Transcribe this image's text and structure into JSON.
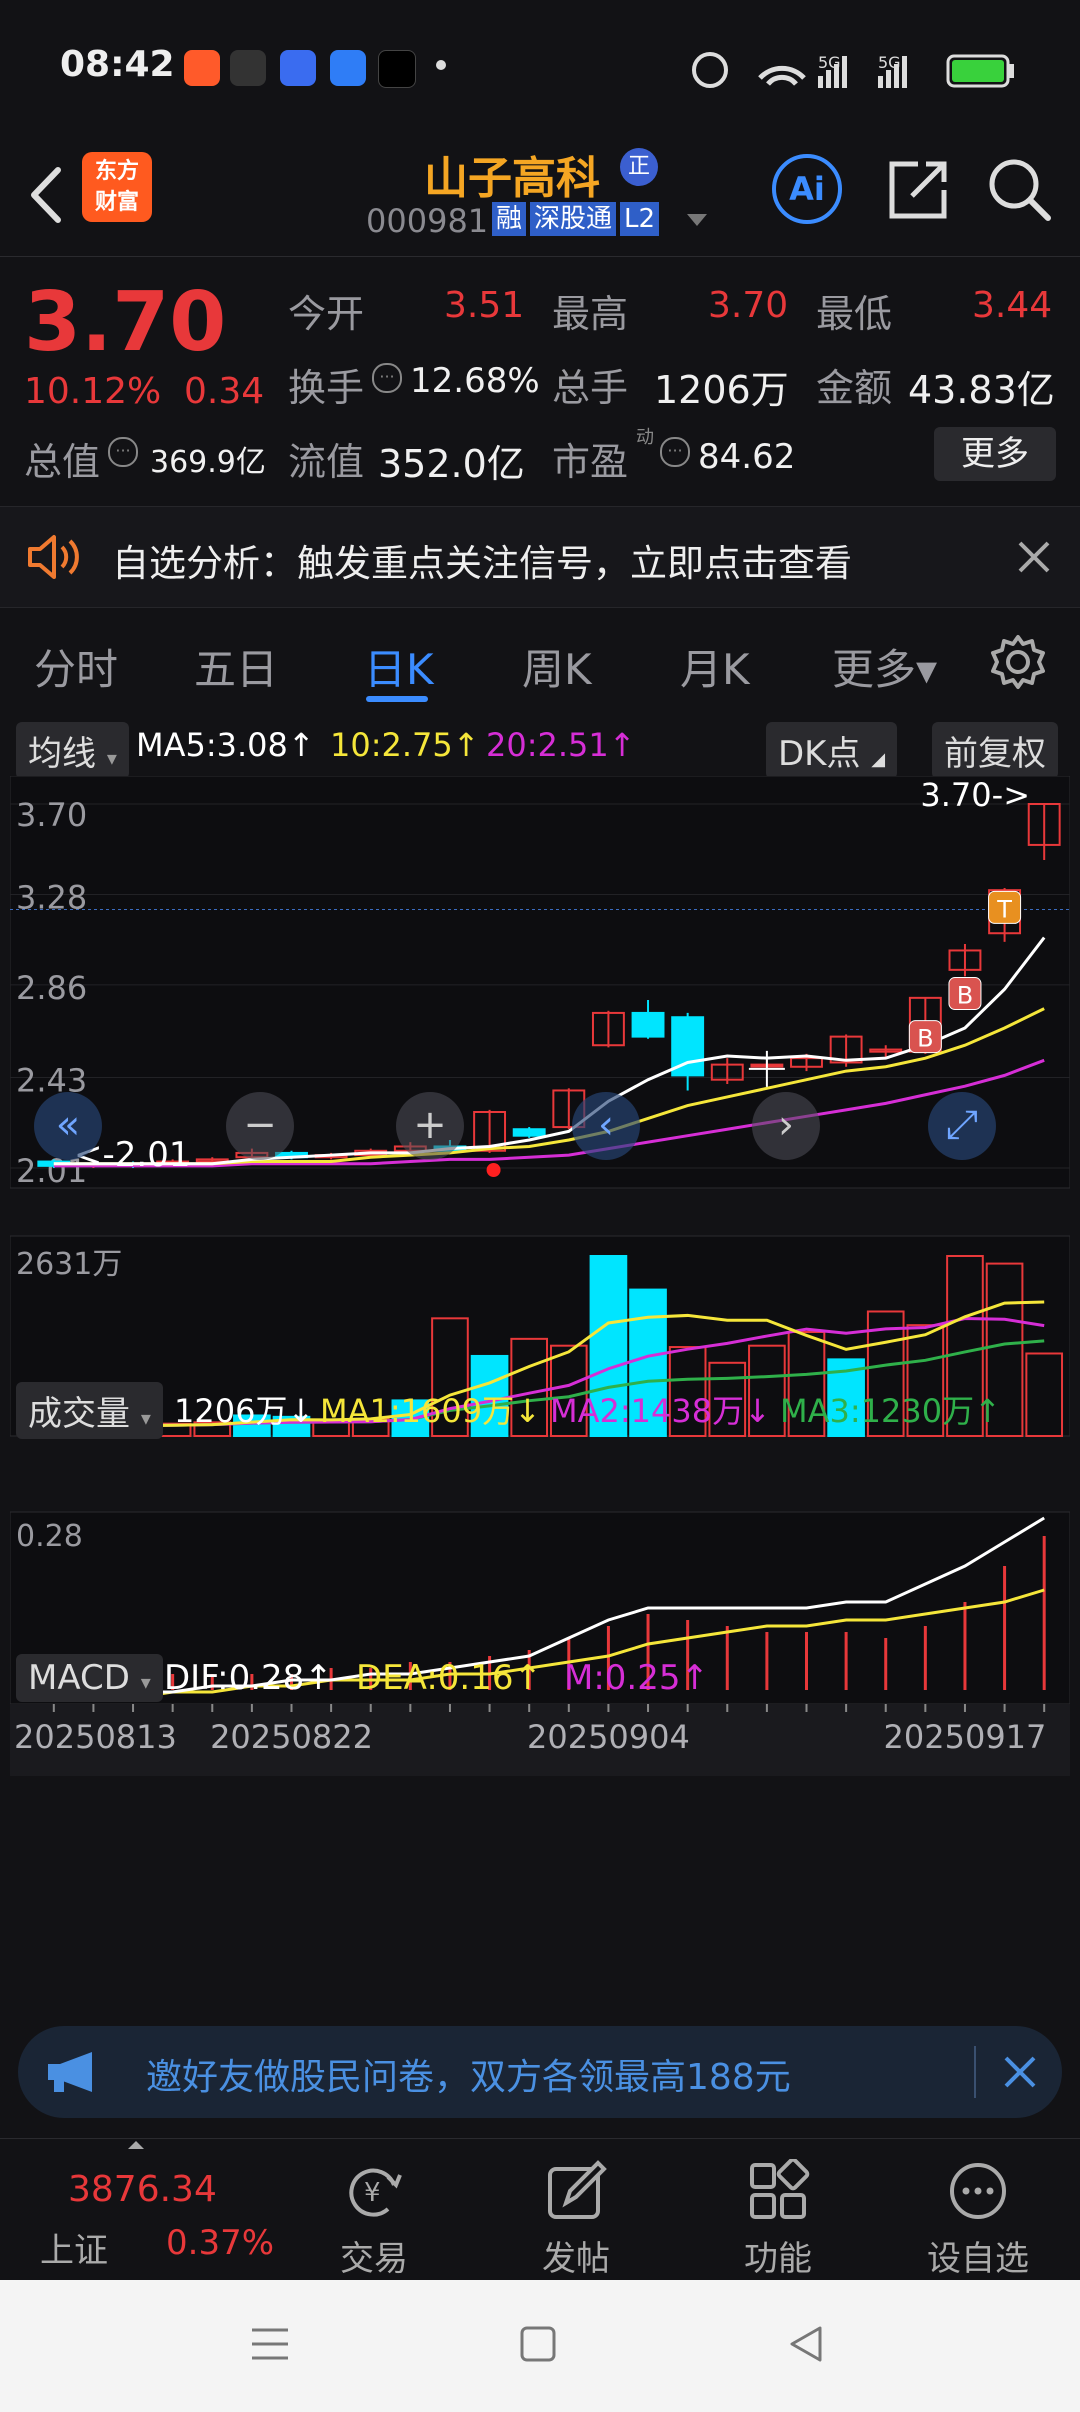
{
  "status": {
    "time": "08:42",
    "network": "5G",
    "network2": "5G"
  },
  "header": {
    "logo_line1": "东方",
    "logo_line2": "财富",
    "stock_name": "山子高科",
    "badge": "正",
    "code": "000981",
    "tags": [
      "融",
      "深股通",
      "L2"
    ],
    "ai_label": "Ai"
  },
  "quote": {
    "price": "3.70",
    "change_pct": "10.12%",
    "change": "0.34",
    "open_label": "今开",
    "open": "3.51",
    "high_label": "最高",
    "high": "3.70",
    "low_label": "最低",
    "low": "3.44",
    "turnover_label": "换手",
    "turnover": "12.68%",
    "volume_label": "总手",
    "volume": "1206万",
    "amount_label": "金额",
    "amount": "43.83亿",
    "mktcap_label": "总值",
    "mktcap": "369.9亿",
    "float_label": "流值",
    "float_cap": "352.0亿",
    "pe_label": "市盈",
    "pe_sup": "动",
    "pe": "84.62",
    "more": "更多"
  },
  "banner": {
    "text": "自选分析：触发重点关注信号，立即点击查看"
  },
  "tabs": [
    {
      "label": "分时"
    },
    {
      "label": "五日"
    },
    {
      "label": "日K"
    },
    {
      "label": "周K"
    },
    {
      "label": "月K"
    },
    {
      "label": "更多▾"
    }
  ],
  "kline": {
    "indicator": "均线",
    "ma5": "MA5:3.08↑",
    "ma10": "10:2.75↑",
    "ma20": "20:2.51↑",
    "dk": "DK点",
    "adjust": "前复权",
    "y_labels": [
      "3.70",
      "3.28",
      "2.86",
      "2.43",
      "2.01"
    ],
    "last_marker": "3.70->",
    "low_marker": "<-2.01",
    "marks": [
      "B",
      "B",
      "T"
    ]
  },
  "volume": {
    "selector": "成交量",
    "vol": "1206万↓",
    "ma1": "MA1:1609万↓",
    "ma2": "MA2:1438万↓",
    "ma3": "MA3:1230万↑",
    "max_label": "2631万"
  },
  "macd": {
    "selector": "MACD",
    "dif": "DIF:0.28↑",
    "dea": "DEA:0.16↑",
    "m": "M:0.25↑",
    "y_top": "0.28",
    "y_bottom": "-0.02",
    "dates": [
      "20250813",
      "20250822",
      "20250904",
      "20250917"
    ]
  },
  "invite": {
    "text": "邀好友做股民问卷，双方各领最高188元"
  },
  "bottomnav": {
    "index_value": "3876.34",
    "index_name": "上证",
    "index_change": "0.37%",
    "items": [
      {
        "label": "交易",
        "icon": "yuan-exchange-icon"
      },
      {
        "label": "发帖",
        "icon": "edit-post-icon"
      },
      {
        "label": "功能",
        "icon": "grid-icon"
      },
      {
        "label": "设自选",
        "icon": "more-dots-icon"
      }
    ]
  },
  "colors": {
    "up": "#e8383a",
    "down": "#00e5ff",
    "ma5": "#ffffff",
    "ma10": "#f5e63a",
    "ma20": "#d62ed6",
    "accent": "#3b8cff"
  },
  "chart_data": {
    "type": "candlestick",
    "candles": [
      {
        "o": 2.04,
        "c": 2.02,
        "h": 2.05,
        "l": 2.01
      },
      {
        "o": 2.02,
        "c": 2.03,
        "h": 2.04,
        "l": 2.01
      },
      {
        "o": 2.03,
        "c": 2.02,
        "h": 2.04,
        "l": 2.01
      },
      {
        "o": 2.02,
        "c": 2.04,
        "h": 2.05,
        "l": 2.02
      },
      {
        "o": 2.04,
        "c": 2.05,
        "h": 2.06,
        "l": 2.03
      },
      {
        "o": 2.06,
        "c": 2.08,
        "h": 2.1,
        "l": 2.05
      },
      {
        "o": 2.08,
        "c": 2.06,
        "h": 2.09,
        "l": 2.05
      },
      {
        "o": 2.06,
        "c": 2.07,
        "h": 2.08,
        "l": 2.05
      },
      {
        "o": 2.07,
        "c": 2.09,
        "h": 2.1,
        "l": 2.06
      },
      {
        "o": 2.09,
        "c": 2.11,
        "h": 2.13,
        "l": 2.08
      },
      {
        "o": 2.11,
        "c": 2.09,
        "h": 2.14,
        "l": 2.08
      },
      {
        "o": 2.09,
        "c": 2.27,
        "h": 2.28,
        "l": 2.08
      },
      {
        "o": 2.19,
        "c": 2.16,
        "h": 2.2,
        "l": 2.15
      },
      {
        "o": 2.2,
        "c": 2.37,
        "h": 2.38,
        "l": 2.19
      },
      {
        "o": 2.58,
        "c": 2.73,
        "h": 2.74,
        "l": 2.57
      },
      {
        "o": 2.73,
        "c": 2.62,
        "h": 2.79,
        "l": 2.61
      },
      {
        "o": 2.71,
        "c": 2.44,
        "h": 2.73,
        "l": 2.37
      },
      {
        "o": 2.42,
        "c": 2.49,
        "h": 2.52,
        "l": 2.4
      },
      {
        "o": 2.49,
        "c": 2.49,
        "h": 2.51,
        "l": 2.47
      },
      {
        "o": 2.48,
        "c": 2.52,
        "h": 2.54,
        "l": 2.46
      },
      {
        "o": 2.5,
        "c": 2.62,
        "h": 2.63,
        "l": 2.48
      },
      {
        "o": 2.55,
        "c": 2.56,
        "h": 2.58,
        "l": 2.52
      },
      {
        "o": 2.55,
        "c": 2.8,
        "h": 2.8,
        "l": 2.54
      },
      {
        "o": 2.93,
        "c": 3.02,
        "h": 3.05,
        "l": 2.9
      },
      {
        "o": 3.1,
        "c": 3.3,
        "h": 3.31,
        "l": 3.06
      },
      {
        "o": 3.51,
        "c": 3.7,
        "h": 3.7,
        "l": 3.44
      }
    ],
    "ma5": [
      2.03,
      2.03,
      2.03,
      2.03,
      2.03,
      2.05,
      2.06,
      2.07,
      2.08,
      2.08,
      2.1,
      2.11,
      2.14,
      2.18,
      2.32,
      2.42,
      2.5,
      2.53,
      2.52,
      2.53,
      2.51,
      2.52,
      2.58,
      2.66,
      2.84,
      3.08
    ],
    "ma10": [
      2.03,
      2.03,
      2.03,
      2.03,
      2.03,
      2.04,
      2.04,
      2.04,
      2.06,
      2.07,
      2.08,
      2.1,
      2.11,
      2.14,
      2.18,
      2.24,
      2.3,
      2.34,
      2.38,
      2.42,
      2.46,
      2.48,
      2.52,
      2.58,
      2.66,
      2.75
    ],
    "ma20": [
      2.02,
      2.02,
      2.02,
      2.02,
      2.02,
      2.03,
      2.03,
      2.03,
      2.03,
      2.04,
      2.05,
      2.05,
      2.06,
      2.07,
      2.1,
      2.13,
      2.16,
      2.19,
      2.22,
      2.25,
      2.28,
      2.31,
      2.35,
      2.39,
      2.44,
      2.51
    ],
    "volume": [
      {
        "v": 120,
        "up": true
      },
      {
        "v": 100,
        "up": false
      },
      {
        "v": 230,
        "up": true
      },
      {
        "v": 180,
        "up": true
      },
      {
        "v": 200,
        "up": true
      },
      {
        "v": 300,
        "up": false
      },
      {
        "v": 280,
        "up": false
      },
      {
        "v": 220,
        "up": true
      },
      {
        "v": 250,
        "up": true
      },
      {
        "v": 520,
        "up": false
      },
      {
        "v": 1720,
        "up": true
      },
      {
        "v": 1170,
        "up": false
      },
      {
        "v": 1420,
        "up": true
      },
      {
        "v": 1320,
        "up": true
      },
      {
        "v": 2631,
        "up": false
      },
      {
        "v": 2140,
        "up": false
      },
      {
        "v": 1300,
        "up": true
      },
      {
        "v": 1070,
        "up": true
      },
      {
        "v": 1320,
        "up": true
      },
      {
        "v": 1520,
        "up": true
      },
      {
        "v": 1120,
        "up": false
      },
      {
        "v": 1820,
        "up": true
      },
      {
        "v": 1620,
        "up": true
      },
      {
        "v": 2631,
        "up": true
      },
      {
        "v": 2520,
        "up": true
      },
      {
        "v": 1206,
        "up": true
      }
    ],
    "macd_m": [
      0.0,
      0.01,
      0.01,
      0.02,
      0.02,
      0.02,
      0.02,
      0.03,
      0.03,
      0.04,
      0.04,
      0.05,
      0.06,
      0.08,
      0.1,
      0.12,
      0.11,
      0.1,
      0.09,
      0.09,
      0.09,
      0.08,
      0.1,
      0.14,
      0.2,
      0.25
    ],
    "dif": [
      -0.02,
      -0.02,
      -0.01,
      -0.01,
      0.0,
      0.0,
      0.01,
      0.01,
      0.02,
      0.02,
      0.03,
      0.04,
      0.05,
      0.08,
      0.11,
      0.13,
      0.13,
      0.13,
      0.13,
      0.13,
      0.14,
      0.14,
      0.17,
      0.2,
      0.24,
      0.28
    ],
    "dea": [
      -0.02,
      -0.02,
      -0.02,
      -0.01,
      -0.01,
      0.0,
      0.0,
      0.01,
      0.01,
      0.01,
      0.02,
      0.02,
      0.03,
      0.04,
      0.05,
      0.07,
      0.08,
      0.09,
      0.1,
      0.1,
      0.11,
      0.11,
      0.12,
      0.13,
      0.14,
      0.16
    ],
    "ylim": [
      2.01,
      3.7
    ],
    "macd_ylim": [
      -0.02,
      0.28
    ]
  }
}
